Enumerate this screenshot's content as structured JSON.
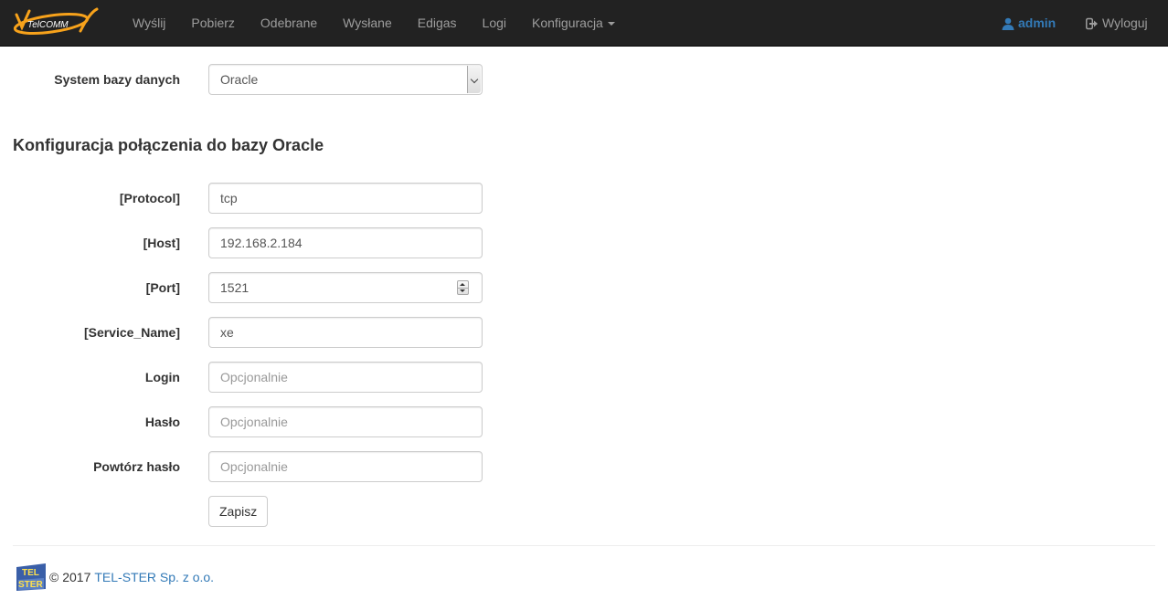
{
  "navbar": {
    "brand": "TelCOMM",
    "items": [
      {
        "label": "Wyślij"
      },
      {
        "label": "Pobierz"
      },
      {
        "label": "Odebrane"
      },
      {
        "label": "Wysłane"
      },
      {
        "label": "Edigas"
      },
      {
        "label": "Logi"
      },
      {
        "label": "Konfiguracja"
      }
    ],
    "user": "admin",
    "logout": "Wyloguj"
  },
  "db_system": {
    "label": "System bazy danych",
    "value": "Oracle"
  },
  "section_title": "Konfiguracja połączenia do bazy Oracle",
  "fields": {
    "protocol": {
      "label": "[Protocol]",
      "value": "tcp"
    },
    "host": {
      "label": "[Host]",
      "value": "192.168.2.184"
    },
    "port": {
      "label": "[Port]",
      "value": "1521"
    },
    "service_name": {
      "label": "[Service_Name]",
      "value": "xe"
    },
    "login": {
      "label": "Login",
      "placeholder": "Opcjonalnie"
    },
    "password": {
      "label": "Hasło",
      "placeholder": "Opcjonalnie"
    },
    "password_repeat": {
      "label": "Powtórz hasło",
      "placeholder": "Opcjonalnie"
    }
  },
  "save_button": "Zapisz",
  "footer": {
    "logo_text_top": "TEL",
    "logo_text_bottom": "STER",
    "copyright": "© 2017",
    "company": "TEL-STER Sp. z o.o."
  },
  "colors": {
    "navbar_bg": "#222222",
    "nav_text": "#9d9d9d",
    "link": "#337ab7",
    "brand_orange": "#f7a21b"
  }
}
